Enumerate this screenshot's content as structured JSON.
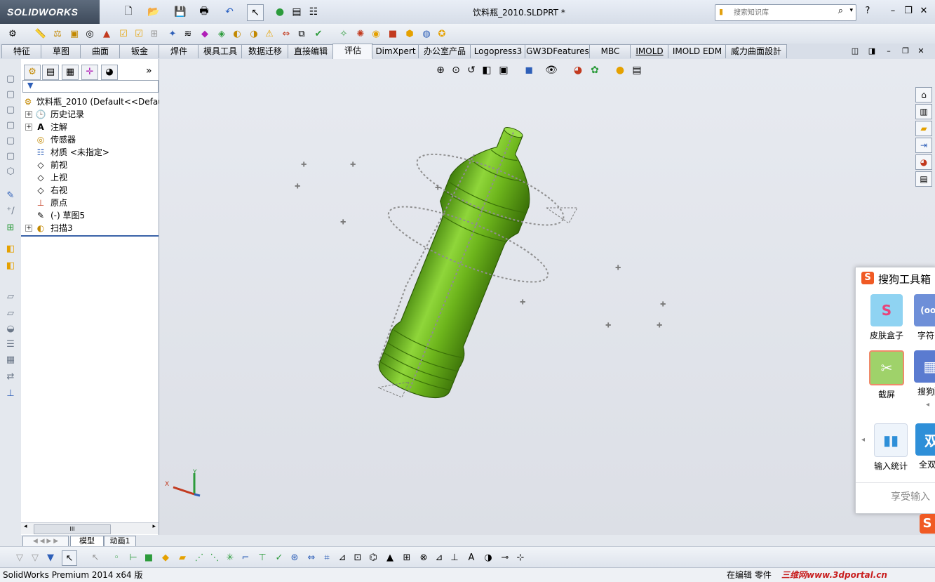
{
  "app": {
    "brand": "SOLIDWORKS",
    "doc_title": "饮料瓶_2010.SLDPRT *"
  },
  "search": {
    "placeholder": "搜索知识库"
  },
  "window_buttons": {
    "help": "?",
    "minimize": "–",
    "restore": "❐",
    "close": "✕"
  },
  "tabs": [
    "特征",
    "草图",
    "曲面",
    "钣金",
    "焊件",
    "模具工具",
    "数据迁移",
    "直接编辑",
    "评估",
    "DimXpert",
    "办公室产品",
    "Logopress3",
    "GW3DFeatures",
    "MBC",
    "IMOLD",
    "IMOLD EDM",
    "威力曲面設計"
  ],
  "active_tab": "评估",
  "tree": {
    "root": "饮料瓶_2010  (Default<<Defau",
    "items": [
      {
        "label": "历史记录",
        "expandable": true
      },
      {
        "label": "注解",
        "expandable": true
      },
      {
        "label": "传感器",
        "expandable": false
      },
      {
        "label": "材质 <未指定>",
        "expandable": false
      },
      {
        "label": "前视",
        "expandable": false
      },
      {
        "label": "上视",
        "expandable": false
      },
      {
        "label": "右视",
        "expandable": false
      },
      {
        "label": "原点",
        "expandable": false
      },
      {
        "label": "(-) 草图5",
        "expandable": false
      },
      {
        "label": "扫描3",
        "expandable": true
      }
    ],
    "scroll_label": "III"
  },
  "panel": {
    "collapse_label": "»"
  },
  "sogou": {
    "title": "搜狗工具箱",
    "apps": [
      "皮肤盒子",
      "字符画",
      "截屏",
      "搜狗酷",
      "输入统计",
      "全双拼"
    ],
    "footer": "享受输入"
  },
  "bottom_tabs": {
    "model": "模型",
    "motion": "动画1"
  },
  "status": {
    "left": "SolidWorks Premium 2014 x64 版",
    "right": "在编辑 零件",
    "watermark": "三维网www.3dportal.cn"
  },
  "triad": {
    "x": "X",
    "y": "Y"
  },
  "colors": {
    "bottle_green": "#6db51c",
    "accent_blue": "#3a63a8"
  }
}
